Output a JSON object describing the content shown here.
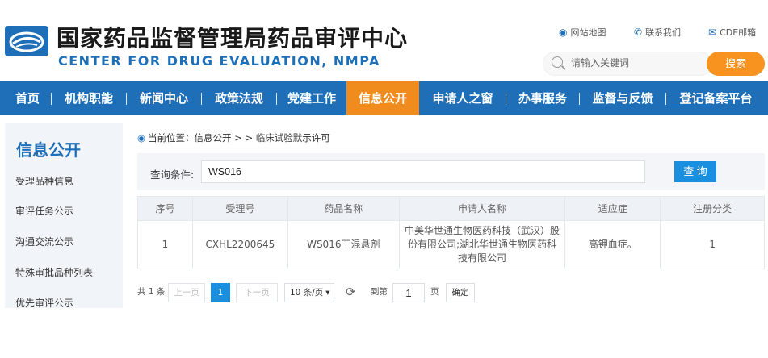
{
  "header": {
    "title_cn": "国家药品监督管理局药品审评中心",
    "title_en": "CENTER FOR DRUG EVALUATION, NMPA",
    "links": {
      "site_map": "网站地图",
      "contact": "联系我们",
      "mail": "CDE邮箱"
    },
    "search": {
      "placeholder": "请输入关键词",
      "button": "搜索"
    }
  },
  "nav": {
    "items": [
      "首页",
      "机构职能",
      "新闻中心",
      "政策法规",
      "党建工作",
      "信息公开",
      "申请人之窗",
      "办事服务",
      "监督与反馈",
      "登记备案平台"
    ],
    "active_index": 5
  },
  "sidebar": {
    "title": "信息公开",
    "items": [
      "受理品种信息",
      "审评任务公示",
      "沟通交流公示",
      "特殊审批品种列表",
      "优先审评公示"
    ]
  },
  "breadcrumb": {
    "prefix": "当前位置：",
    "path": "信息公开 > > 临床试验默示许可"
  },
  "query": {
    "label": "查询条件:",
    "value": "WS016",
    "button": "查 询"
  },
  "table": {
    "headers": [
      "序号",
      "受理号",
      "药品名称",
      "申请人名称",
      "适应症",
      "注册分类"
    ],
    "rows": [
      [
        "1",
        "CXHL2200645",
        "WS016干混悬剂",
        "中美华世通生物医药科技（武汉）股份有限公司;湖北华世通生物医药科技有限公司",
        "高钾血症。",
        "1"
      ]
    ]
  },
  "pagination": {
    "total": "共 1 条",
    "prev": "上一页",
    "current": "1",
    "next": "下一页",
    "page_size": "10 条/页",
    "goto_label": "到第",
    "goto_value": "1",
    "page_unit": "页",
    "confirm": "确定"
  },
  "colors": {
    "primary": "#1e6fb8",
    "accent": "#f08c1e",
    "search_button": "#f7931e",
    "query_button": "#1a8fe0"
  }
}
